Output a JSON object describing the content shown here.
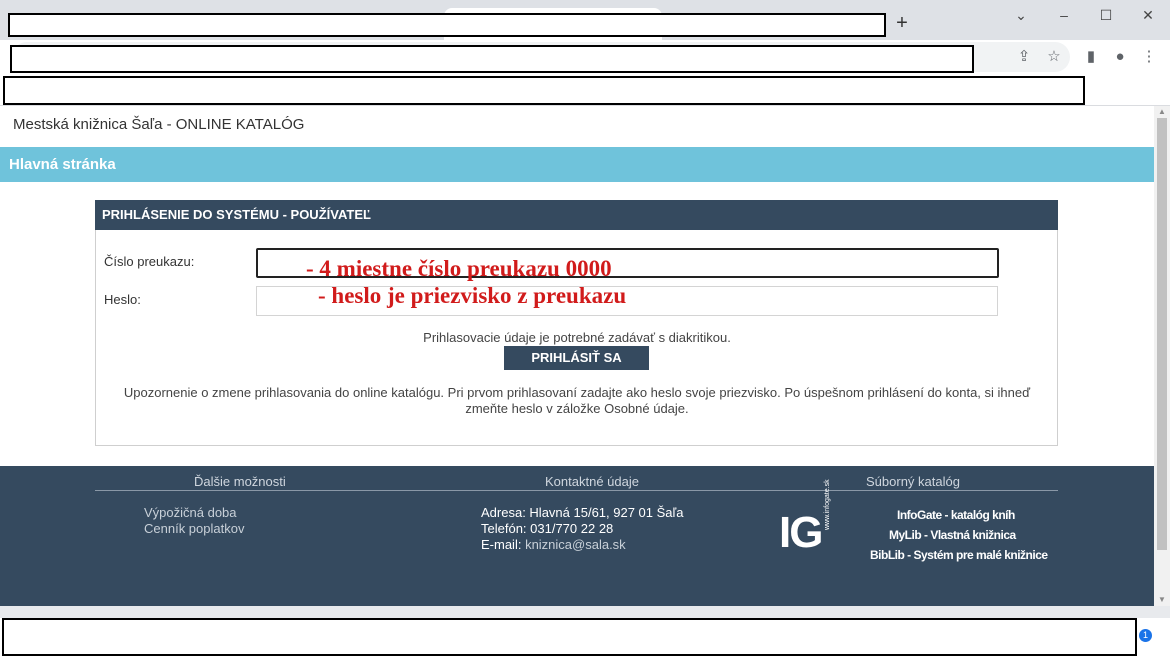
{
  "browser": {
    "new_tab_icon": "+",
    "icons": {
      "minimize": "–",
      "maximize": "☐",
      "close": "✕",
      "tab_search": "⌄",
      "share": "⇪",
      "bookmark_star": "☆",
      "side_panel": "▮",
      "profile": "●",
      "menu": "⋮"
    },
    "notification_count": "1"
  },
  "site": {
    "title": "Mestská knižnica Šaľa - ONLINE KATALÓG",
    "nav_home": "Hlavná stránka"
  },
  "login": {
    "header": "PRIHLÁSENIE DO SYSTÉMU - POUŽÍVATEĽ",
    "card_label": "Číslo preukazu:",
    "password_label": "Heslo:",
    "card_note": "- 4 miestne číslo preukazu  0000",
    "password_note": "-  heslo je priezvisko z preukazu",
    "diacritics_note": "Prihlasovacie údaje je potrebné zadávať s diakritikou.",
    "button": "PRIHLÁSIŤ SA",
    "warning": "Upozornenie o zmene prihlasovania do online katalógu. Pri prvom prihlasovaní zadajte ako heslo svoje priezvisko. Po úspešnom prihlásení do konta, si ihneď zmeňte heslo v záložke Osobné údaje."
  },
  "footer": {
    "col1_title": "Ďalšie možnosti",
    "col2_title": "Kontaktné údaje",
    "col3_title": "Súborný katalóg",
    "links": [
      "Výpožičná doba",
      "Cenník poplatkov"
    ],
    "address": "Adresa: Hlavná 15/61, 927 01 Šaľa",
    "phone": "Telefón: 031/770 22 28",
    "email_label": "E-mail: ",
    "email": "kniznica@sala.sk",
    "logo_text": "IG",
    "logo_vertical": "www.infogate.sk",
    "products": [
      "InfoGate - katalóg kníh",
      "MyLib - Vlastná knižnica",
      "BibLib - Systém pre malé knižnice"
    ]
  },
  "colors": {
    "nav_blue": "#6fc3db",
    "dark_navy": "#354a5f",
    "annotation_red": "#d11b1b"
  }
}
